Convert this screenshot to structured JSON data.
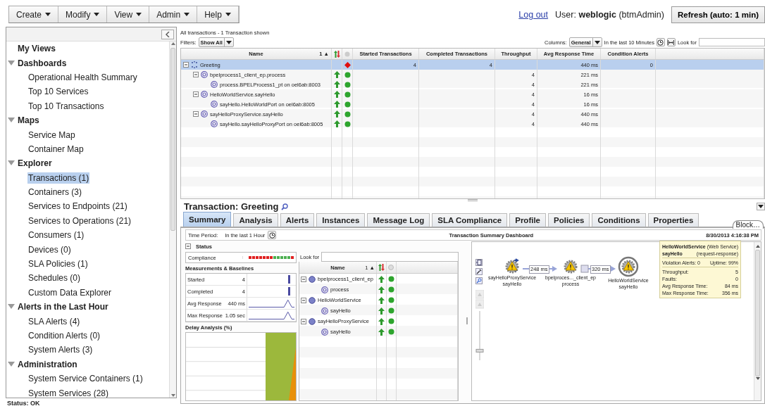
{
  "menu": [
    {
      "label": "Create"
    },
    {
      "label": "Modify"
    },
    {
      "label": "View"
    },
    {
      "label": "Admin"
    },
    {
      "label": "Help"
    }
  ],
  "header": {
    "logout": "Log out",
    "user_label": "User:",
    "user_name": "weblogic",
    "role": "(btmAdmin)",
    "refresh": "Refresh (auto: 1 min)"
  },
  "sidebar": {
    "tree": [
      {
        "label": "My Views",
        "kind": "root"
      },
      {
        "label": "Dashboards",
        "kind": "group",
        "expanded": true,
        "children": [
          {
            "label": "Operational Health Summary",
            "selected": false
          },
          {
            "label": "Top 10 Services",
            "selected": false
          },
          {
            "label": "Top 10 Transactions",
            "selected": false
          }
        ]
      },
      {
        "label": "Maps",
        "kind": "group",
        "expanded": true,
        "children": [
          {
            "label": "Service Map",
            "selected": false
          },
          {
            "label": "Container Map",
            "selected": false
          }
        ]
      },
      {
        "label": "Explorer",
        "kind": "group",
        "expanded": true,
        "children": [
          {
            "label": "Transactions (1)",
            "selected": true
          },
          {
            "label": "Containers (3)",
            "selected": false
          },
          {
            "label": "Services to Endpoints (21)",
            "selected": false
          },
          {
            "label": "Services to Operations (21)",
            "selected": false
          },
          {
            "label": "Consumers (1)",
            "selected": false
          },
          {
            "label": "Devices (0)",
            "selected": false
          },
          {
            "label": "SLA Policies (1)",
            "selected": false
          },
          {
            "label": "Schedules (0)",
            "selected": false
          },
          {
            "label": "Custom Data Explorer",
            "selected": false
          }
        ]
      },
      {
        "label": "Alerts in the Last Hour",
        "kind": "group",
        "expanded": true,
        "children": [
          {
            "label": "SLA Alerts (4)",
            "selected": false
          },
          {
            "label": "Condition Alerts (0)",
            "selected": false
          },
          {
            "label": "System Alerts (3)",
            "selected": false
          }
        ]
      },
      {
        "label": "Administration",
        "kind": "group",
        "expanded": true,
        "children": [
          {
            "label": "System Service Containers (1)",
            "selected": false
          },
          {
            "label": "System Services (28)",
            "selected": false
          }
        ]
      }
    ]
  },
  "status_bar": "Status: OK",
  "transactions": {
    "summary": "All transactions  - 1 Transaction shown",
    "filters_label": "Filters:",
    "filter": "Show All",
    "columns_label": "Columns:",
    "columns_value": "General",
    "period": "In the last 10 Minutes",
    "look_for": "Look for",
    "columns": [
      "Name",
      "Started Transactions",
      "Completed Transactions",
      "Throughput",
      "Avg Response Time",
      "Condition Alerts"
    ],
    "sort": "1 ▲",
    "rows": [
      {
        "name": "Greeting",
        "kind": "transaction",
        "rising": false,
        "alert": true,
        "color": "#e01010",
        "started": "4",
        "completed": "4",
        "avg": "440 ms",
        "alerts": "0",
        "selected": true,
        "expanded": true,
        "children": [
          {
            "name": "bpelprocess1_client_ep.process",
            "kind": "operation",
            "rising": true,
            "alert": false,
            "color": "#2ea52e",
            "throughput": "4",
            "avg": "221 ms",
            "selected": false,
            "expanded": true,
            "children": [
              {
                "name": "process.BPELProcess1_pt on oel6ab:8003",
                "kind": "endpoint",
                "rising": true,
                "alert": false,
                "color": "#2ea52e",
                "throughput": "4",
                "avg": "221 ms",
                "selected": false
              }
            ]
          },
          {
            "name": "HelloWorldService.sayHello",
            "kind": "operation",
            "rising": true,
            "alert": false,
            "color": "#2ea52e",
            "throughput": "4",
            "avg": "16 ms",
            "selected": false,
            "expanded": true,
            "children": [
              {
                "name": "sayHello.HelloWorldPort on oel6ab:8005",
                "kind": "endpoint",
                "rising": true,
                "alert": false,
                "color": "#2ea52e",
                "throughput": "4",
                "avg": "16 ms",
                "selected": false
              }
            ]
          },
          {
            "name": "sayHelloProxyService.sayHello",
            "kind": "operation",
            "rising": true,
            "alert": false,
            "color": "#2ea52e",
            "throughput": "4",
            "avg": "440 ms",
            "selected": false,
            "expanded": true,
            "children": [
              {
                "name": "sayHello.sayHelloProxyPort on oel6ab:8005",
                "kind": "endpoint",
                "rising": true,
                "alert": false,
                "color": "#2ea52e",
                "throughput": "4",
                "avg": "440 ms",
                "selected": false
              }
            ]
          }
        ]
      }
    ]
  },
  "detail": {
    "title": "Transaction: Greeting",
    "tabs": [
      {
        "label": "Summary",
        "selected": true
      },
      {
        "label": "Analysis",
        "selected": false
      },
      {
        "label": "Alerts",
        "selected": false
      },
      {
        "label": "Instances",
        "selected": false
      },
      {
        "label": "Message Log",
        "selected": false
      },
      {
        "label": "SLA Compliance",
        "selected": false
      },
      {
        "label": "Profile",
        "selected": false
      },
      {
        "label": "Policies",
        "selected": false
      },
      {
        "label": "Conditions",
        "selected": false
      },
      {
        "label": "Properties",
        "selected": false
      }
    ],
    "block_tab": "Block…",
    "time_period_label": "Time Period:",
    "time_period": "In the last 1 Hour",
    "dashboard_title": "Transaction Summary Dashboard",
    "timestamp": "8/30/2013 4:16:38 PM",
    "status_heading": "Status",
    "compliance": {
      "label": "Compliance",
      "squares": [
        {
          "color": "#e02020"
        },
        {
          "color": "#e02020"
        },
        {
          "color": "#e02020"
        },
        {
          "color": "#e02020"
        },
        {
          "color": "#e02020"
        },
        {
          "color": "#e02020"
        },
        {
          "color": "#e02020"
        },
        {
          "color": "#4caf50"
        },
        {
          "color": "#4caf50"
        },
        {
          "color": "#4caf50"
        },
        {
          "color": "#4caf50"
        },
        {
          "color": "#4caf50"
        },
        {
          "color": "#e02020"
        }
      ]
    },
    "measurements_heading": "Measurements & Baselines",
    "measurements": [
      {
        "label": "Started",
        "value": "4",
        "kind": "bar"
      },
      {
        "label": "Completed",
        "value": "4",
        "kind": "bar"
      },
      {
        "label": "Avg Response",
        "value": "440 ms",
        "kind": "peak"
      },
      {
        "label": "Max Response",
        "value": "1.05 sec",
        "kind": "peak"
      }
    ],
    "delay_heading": "Delay Analysis (%)",
    "look_for": "Look for",
    "sort": "1 ▲",
    "name_column": "Name",
    "operations": [
      {
        "name": "bpelprocess1_client_ep",
        "kind": "service",
        "rising": true,
        "alert": false,
        "color": "#2ea52e",
        "expanded": true,
        "children": [
          {
            "name": "process",
            "kind": "operation",
            "rising": true,
            "alert": false,
            "color": "#2ea52e"
          }
        ]
      },
      {
        "name": "HelloWorldService",
        "kind": "service",
        "rising": true,
        "alert": false,
        "color": "#2ea52e",
        "expanded": true,
        "children": [
          {
            "name": "sayHello",
            "kind": "operation",
            "rising": true,
            "alert": false,
            "color": "#2ea52e"
          }
        ]
      },
      {
        "name": "sayHelloProxyService",
        "kind": "service",
        "rising": true,
        "alert": false,
        "color": "#2ea52e",
        "expanded": true,
        "children": [
          {
            "name": "sayHello",
            "kind": "operation",
            "rising": true,
            "alert": false,
            "color": "#2ea52e"
          }
        ]
      }
    ],
    "diagram": {
      "zoom": {
        "level": 0.2
      },
      "nodes": [
        {
          "name": "sayHelloProxyService",
          "operation": "sayHello",
          "selected": false
        },
        {
          "name": "bpelproces..._client_ep",
          "operation": "process",
          "selected": false
        },
        {
          "name": "HelloWorldService",
          "operation": "sayHello",
          "selected": true
        }
      ],
      "edges": [
        {
          "label": "248 ms"
        },
        {
          "label": "320 ms"
        }
      ],
      "tooltip": {
        "title": "HelloWorldService",
        "type": "(Web Service)",
        "operation": "sayHello",
        "operation_type": "(request-response)",
        "violations": "Violation Alerts: 0",
        "uptime": "Uptime: 99%",
        "metrics": [
          {
            "label": "Throughput:",
            "value": "5"
          },
          {
            "label": "Faults:",
            "value": "0"
          },
          {
            "label": "Avg Response Time:",
            "value": "84 ms"
          },
          {
            "label": "Max Response Time:",
            "value": "356 ms"
          }
        ]
      }
    }
  }
}
